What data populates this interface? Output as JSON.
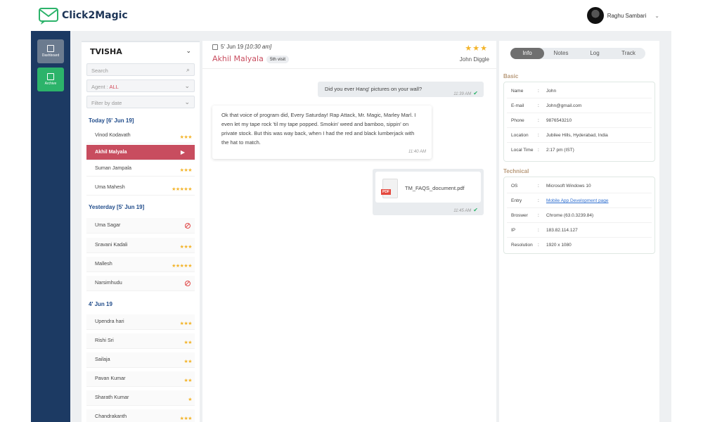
{
  "app": {
    "name": "Click2Magic"
  },
  "user": {
    "name": "Raghu Sambari"
  },
  "rail": {
    "dashboard_label": "Dashboard",
    "archive_label": "Archive"
  },
  "list": {
    "title": "TVISHA",
    "search_placeholder": "Search",
    "agent_prefix": "Agent : ",
    "agent_value": "ALL",
    "filter_placeholder": "Filter by date",
    "groups": [
      {
        "title": "Today [6' Jun 19]",
        "rows": [
          {
            "name": "Vinod Kodavath",
            "stars": "★★★"
          },
          {
            "name": "Akhil Malyala",
            "active": true
          },
          {
            "name": "Suman Jampala",
            "stars": "★★★"
          },
          {
            "name": "Uma Mahesh",
            "stars": "★★★★★"
          }
        ]
      },
      {
        "title": "Yesterday [5' Jun 19]",
        "rows": [
          {
            "name": "Uma Sagar",
            "blocked": true
          },
          {
            "name": "Sravani Kadali",
            "stars": "★★★"
          },
          {
            "name": "Mallesh",
            "stars": "★★★★★"
          },
          {
            "name": "Narsimhudu",
            "blocked": true
          }
        ]
      },
      {
        "title": "4' Jun 19",
        "rows": [
          {
            "name": "Upendra hari",
            "stars": "★★★"
          },
          {
            "name": "Rishi Sri",
            "stars": "★★"
          },
          {
            "name": "Sailaja",
            "stars": "★★"
          },
          {
            "name": "Pavan Kumar",
            "stars": "★★"
          },
          {
            "name": "Sharath Kumar",
            "stars": "★"
          },
          {
            "name": "Chandrakanth",
            "stars": "★★★"
          }
        ]
      }
    ]
  },
  "conversation": {
    "date": "5' Jun 19",
    "time": "[10:30 am]",
    "visitor": "Akhil Malyala",
    "visit_badge": "5th visit",
    "stars": "★★★",
    "agent": "John Diggle",
    "messages": [
      {
        "dir": "out",
        "text": "Did you ever Hang' pictures on your wall?",
        "time": "11:39 AM"
      },
      {
        "dir": "in",
        "text": "Ok that voice of program did, Every Saturday! Rap Attack, Mr. Magic, Marley Marl. I even let my tape rock 'til my tape popped. Smokin' weed and bamboo, sippin' on private stock. But this was way back, when I had the red and black lumberjack with the hat to match.",
        "time": "11:40 AM"
      },
      {
        "dir": "out",
        "file": "TM_FAQS_document.pdf",
        "file_badge": "PDF",
        "time": "11:45 AM"
      }
    ]
  },
  "info": {
    "tabs": [
      "Info",
      "Notes",
      "Log",
      "Track"
    ],
    "basic_title": "Basic",
    "basic": [
      {
        "k": "Name",
        "v": "John"
      },
      {
        "k": "E-mail",
        "v": "John@gmail.com"
      },
      {
        "k": "Phone",
        "v": "9876543210"
      },
      {
        "k": "Location",
        "v": "Jubilee Hills, Hyderabad, India"
      },
      {
        "k": "Local Time",
        "v": "2:17 pm (IST)"
      }
    ],
    "technical_title": "Technical",
    "technical": [
      {
        "k": "OS",
        "v": "Microsoft Windows 10"
      },
      {
        "k": "Entry",
        "v": "Mobile App Development page",
        "link": true
      },
      {
        "k": "Broswer",
        "v": "Chrome (63.0.3239.84)"
      },
      {
        "k": "IP",
        "v": "183.82.114.127"
      },
      {
        "k": "Resolution",
        "v": "1920 x 1080"
      }
    ]
  },
  "colors": {
    "accent": "#c84d5f",
    "rail": "#1c3a63",
    "stars": "#f3b42a",
    "online": "#2cb36a"
  }
}
